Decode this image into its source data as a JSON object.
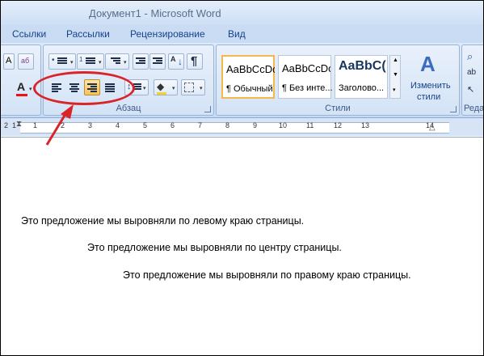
{
  "window": {
    "title": "Документ1 - Microsoft Word"
  },
  "tabs": [
    "Ссылки",
    "Рассылки",
    "Рецензирование",
    "Вид"
  ],
  "groups": {
    "paragraph": "Абзац",
    "styles": "Стили",
    "editing_partial": "Реда"
  },
  "styles": [
    {
      "sample": "AaBbCcDc",
      "name": "¶ Обычный"
    },
    {
      "sample": "AaBbCcDc",
      "name": "¶ Без инте..."
    },
    {
      "sample": "AaBbC(",
      "name": "Заголово..."
    }
  ],
  "change_styles": {
    "line1": "Изменить",
    "line2": "стили"
  },
  "ruler": {
    "numbers": [
      "2",
      "1",
      "1",
      "2",
      "3",
      "4",
      "5",
      "6",
      "7",
      "8",
      "9",
      "10",
      "11",
      "12",
      "13",
      "14"
    ]
  },
  "document": {
    "lines": [
      "Это предложение мы выровняли по левому краю страницы.",
      "Это предложение мы выровняли по центру страницы.",
      "Это предложение мы выровняли по правому краю страницы."
    ]
  },
  "colors": {
    "annotation": "#d9242a",
    "active_button": "#f8c15a"
  }
}
